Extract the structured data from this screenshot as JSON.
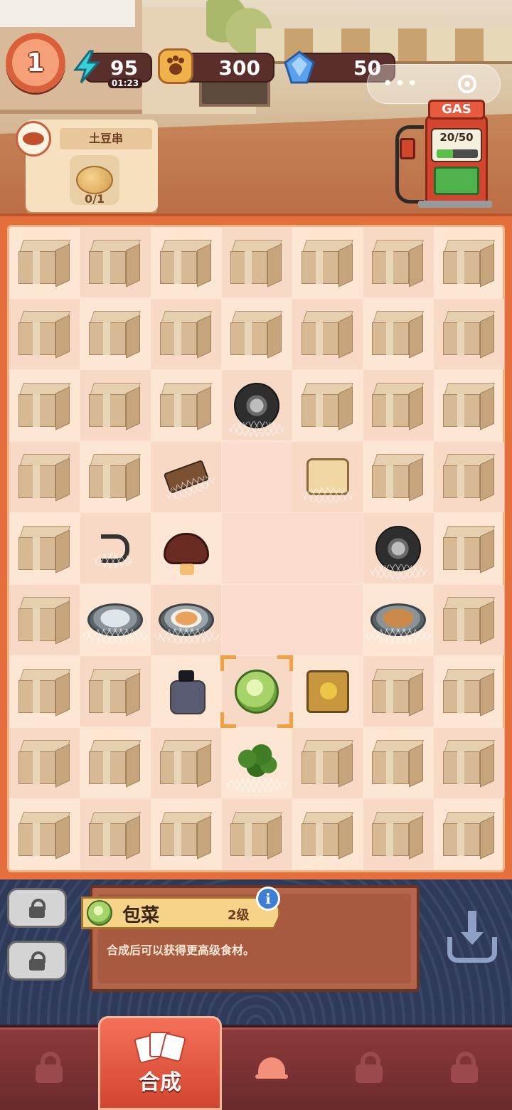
{
  "hud": {
    "level": "1",
    "energy": "95",
    "energy_timer": "01:23",
    "coins": "300",
    "gems": "50"
  },
  "order": {
    "dish_name": "土豆串",
    "progress": "0/1"
  },
  "gas_pump": {
    "label": "GAS",
    "fuel": "20/50",
    "fuel_fraction": 0.4
  },
  "board": {
    "columns": 7,
    "rows": 9,
    "cells": [
      [
        "box",
        "box",
        "box",
        "box",
        "box",
        "box",
        "box"
      ],
      [
        "box",
        "box",
        "box",
        "box",
        "box",
        "box",
        "box"
      ],
      [
        "box",
        "box",
        "box",
        "tire",
        "box",
        "box",
        "box"
      ],
      [
        "box",
        "box",
        "clamp",
        "empty",
        "cheese",
        "box",
        "box"
      ],
      [
        "box",
        "hook",
        "mushroom",
        "empty",
        "empty",
        "tires",
        "box"
      ],
      [
        "box",
        "pot",
        "soup-pot",
        "empty",
        "empty",
        "curry-pot",
        "box"
      ],
      [
        "box",
        "box",
        "ink-bottle",
        "cabbage",
        "paper-bag",
        "box",
        "box"
      ],
      [
        "box",
        "box",
        "box",
        "broccoli",
        "box",
        "box",
        "box"
      ],
      [
        "box",
        "box",
        "box",
        "box",
        "box",
        "box",
        "box"
      ]
    ],
    "selected": {
      "row": 6,
      "col": 3
    }
  },
  "selected_item": {
    "name": "包菜",
    "level": "2级",
    "info_icon": "i",
    "description": "合成后可以获得更高级食材。"
  },
  "nav": {
    "tabs": [
      {
        "icon": "lock-icon",
        "label": ""
      },
      {
        "icon": "cards-icon",
        "label": "合成"
      },
      {
        "icon": "bell-icon",
        "label": ""
      },
      {
        "icon": "lock-icon",
        "label": ""
      },
      {
        "icon": "lock-icon",
        "label": ""
      }
    ]
  }
}
